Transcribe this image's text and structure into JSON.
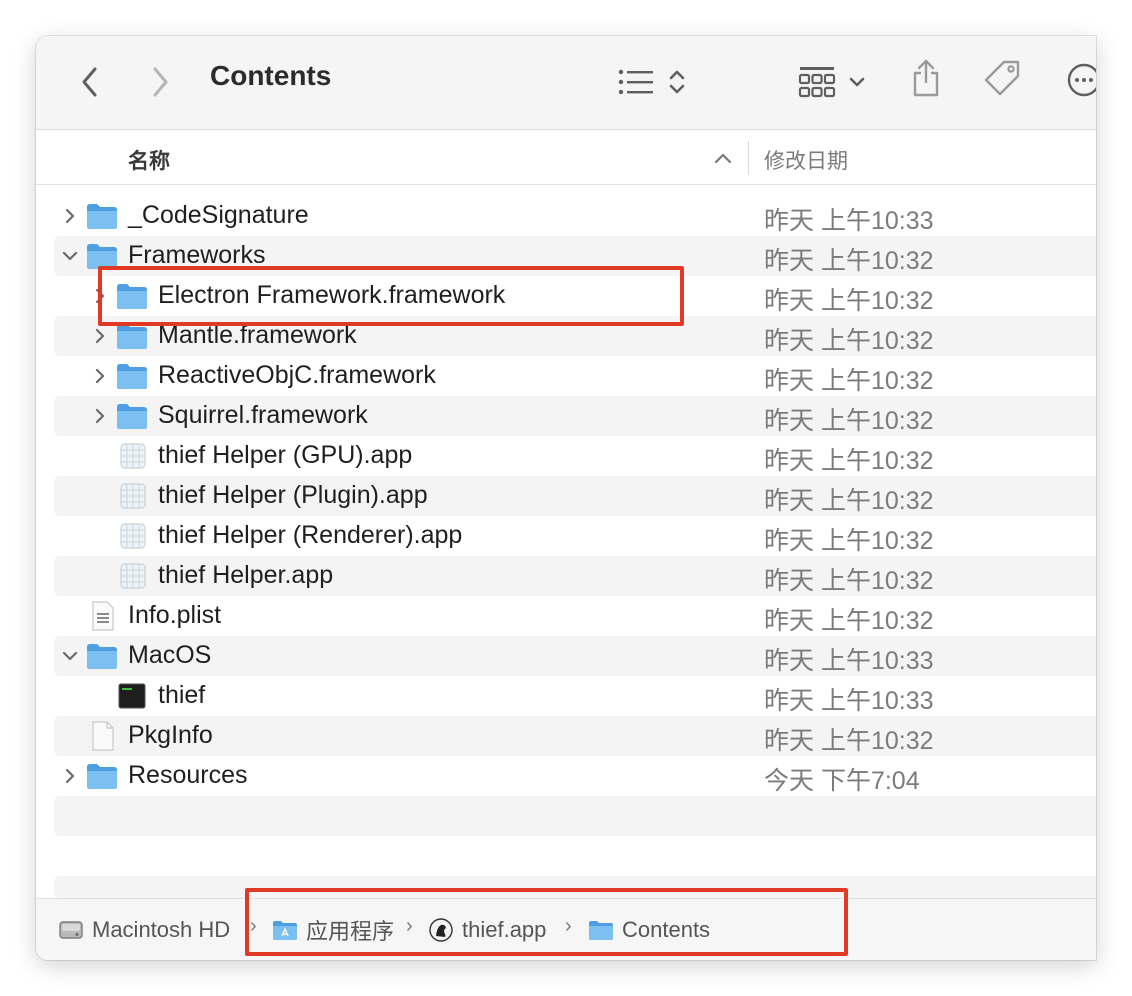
{
  "toolbar": {
    "title": "Contents",
    "icons": [
      "back-icon",
      "forward-icon",
      "list-view-icon",
      "sort-icon",
      "group-icon",
      "share-icon",
      "tag-icon",
      "more-icon"
    ]
  },
  "header": {
    "name_col": "名称",
    "date_col": "修改日期"
  },
  "rows": [
    {
      "name": "_CodeSignature",
      "date": "昨天 上午10:33",
      "icon": "folder-icon",
      "disclosure": "collapsed"
    },
    {
      "name": "Frameworks",
      "date": "昨天 上午10:32",
      "icon": "folder-icon",
      "disclosure": "expanded"
    },
    {
      "name": "Electron Framework.framework",
      "date": "昨天 上午10:32",
      "icon": "folder-icon",
      "disclosure": "collapsed"
    },
    {
      "name": "Mantle.framework",
      "date": "昨天 上午10:32",
      "icon": "folder-icon",
      "disclosure": "collapsed"
    },
    {
      "name": "ReactiveObjC.framework",
      "date": "昨天 上午10:32",
      "icon": "folder-icon",
      "disclosure": "collapsed"
    },
    {
      "name": "Squirrel.framework",
      "date": "昨天 上午10:32",
      "icon": "folder-icon",
      "disclosure": "collapsed"
    },
    {
      "name": "thief Helper (GPU).app",
      "date": "昨天 上午10:32",
      "icon": "app-icon",
      "disclosure": "none"
    },
    {
      "name": "thief Helper (Plugin).app",
      "date": "昨天 上午10:32",
      "icon": "app-icon",
      "disclosure": "none"
    },
    {
      "name": "thief Helper (Renderer).app",
      "date": "昨天 上午10:32",
      "icon": "app-icon",
      "disclosure": "none"
    },
    {
      "name": "thief Helper.app",
      "date": "昨天 上午10:32",
      "icon": "app-icon",
      "disclosure": "none"
    },
    {
      "name": "Info.plist",
      "date": "昨天 上午10:32",
      "icon": "plist-icon",
      "disclosure": "none"
    },
    {
      "name": "MacOS",
      "date": "昨天 上午10:33",
      "icon": "folder-icon",
      "disclosure": "expanded"
    },
    {
      "name": "thief",
      "date": "昨天 上午10:33",
      "icon": "terminal-icon",
      "disclosure": "none"
    },
    {
      "name": "PkgInfo",
      "date": "昨天 上午10:32",
      "icon": "document-icon",
      "disclosure": "none"
    },
    {
      "name": "Resources",
      "date": "今天 下午7:04",
      "icon": "folder-icon",
      "disclosure": "collapsed"
    }
  ],
  "pathbar": {
    "items": [
      {
        "label": "Macintosh HD",
        "icon": "hard-drive-icon"
      },
      {
        "label": "应用程序",
        "icon": "applications-folder-icon"
      },
      {
        "label": "thief.app",
        "icon": "app-logo-icon"
      },
      {
        "label": "Contents",
        "icon": "folder-icon"
      }
    ]
  },
  "colors": {
    "highlight": "#e03a27",
    "folder": "#5aa9e6",
    "alt_row": "#f4f4f4"
  }
}
